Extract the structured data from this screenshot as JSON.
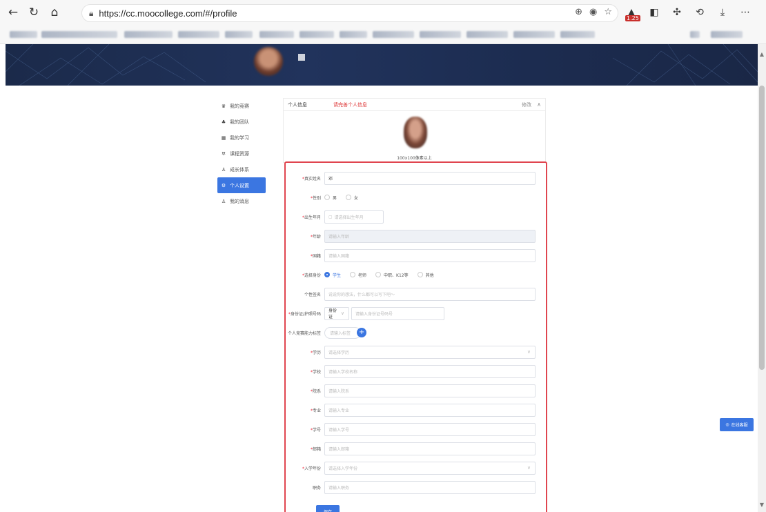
{
  "browser": {
    "url": "https://cc.moocollege.com/#/profile",
    "ext_badge": "1.25",
    "icons": [
      "back-icon",
      "refresh-icon",
      "home-icon",
      "lock-icon",
      "zoom-icon",
      "ext-icon",
      "favorite-icon",
      "collections-icon",
      "history-icon",
      "download-icon",
      "more-icon"
    ]
  },
  "sidebar": {
    "items": [
      {
        "label": "我的竞赛",
        "icon": "trophy-icon",
        "active": false
      },
      {
        "label": "我的团队",
        "icon": "team-icon",
        "active": false
      },
      {
        "label": "我的学习",
        "icon": "book-icon",
        "active": false
      },
      {
        "label": "课程资源",
        "icon": "resource-icon",
        "active": false
      },
      {
        "label": "成长体系",
        "icon": "growth-icon",
        "active": false
      },
      {
        "label": "个人设置",
        "icon": "settings-icon",
        "active": true
      },
      {
        "label": "我的消息",
        "icon": "message-icon",
        "active": false
      }
    ]
  },
  "card": {
    "title": "个人信息",
    "warning": "请完善个人信息",
    "edit": "修改",
    "avatar_caption": "100x100像素以上"
  },
  "form": {
    "real_name": {
      "label": "真实姓名",
      "value": "邓"
    },
    "gender": {
      "label": "性别",
      "options": [
        "男",
        "女"
      ]
    },
    "birth": {
      "label": "出生年月",
      "placeholder": "请选择出生年月"
    },
    "age": {
      "label": "年龄",
      "placeholder": "请输入年龄"
    },
    "nation": {
      "label": "国籍",
      "placeholder": "请输入国籍"
    },
    "identity": {
      "label": "选择身份",
      "options": [
        "学生",
        "老师",
        "中职、K12等",
        "其他"
      ],
      "selected": "学生"
    },
    "signature": {
      "label": "个性签名",
      "placeholder": "说说你的想法，什么都可以写下吧～"
    },
    "idcard": {
      "label": "身份证/护照号码",
      "type": "身份证",
      "placeholder": "请输入身份证号码号"
    },
    "ability": {
      "label": "个人竞赛能力标签",
      "placeholder": "请输入标签"
    },
    "education": {
      "label": "学历",
      "placeholder": "请选择学历"
    },
    "school": {
      "label": "学校",
      "placeholder": "请输入学校名称"
    },
    "department": {
      "label": "院系",
      "placeholder": "请输入院系"
    },
    "major": {
      "label": "专业",
      "placeholder": "请输入专业"
    },
    "student_no": {
      "label": "学号",
      "placeholder": "请输入学号"
    },
    "email": {
      "label": "邮箱",
      "placeholder": "请输入邮箱"
    },
    "enroll_year": {
      "label": "入学年份",
      "placeholder": "请选择入学年份"
    },
    "position": {
      "label": "职务",
      "placeholder": "请输入职务"
    },
    "save": "保存"
  },
  "online_service": "在线客服",
  "colors": {
    "accent": "#3b76e1",
    "highlight": "#e0454f",
    "banner": "#1f2f54"
  }
}
